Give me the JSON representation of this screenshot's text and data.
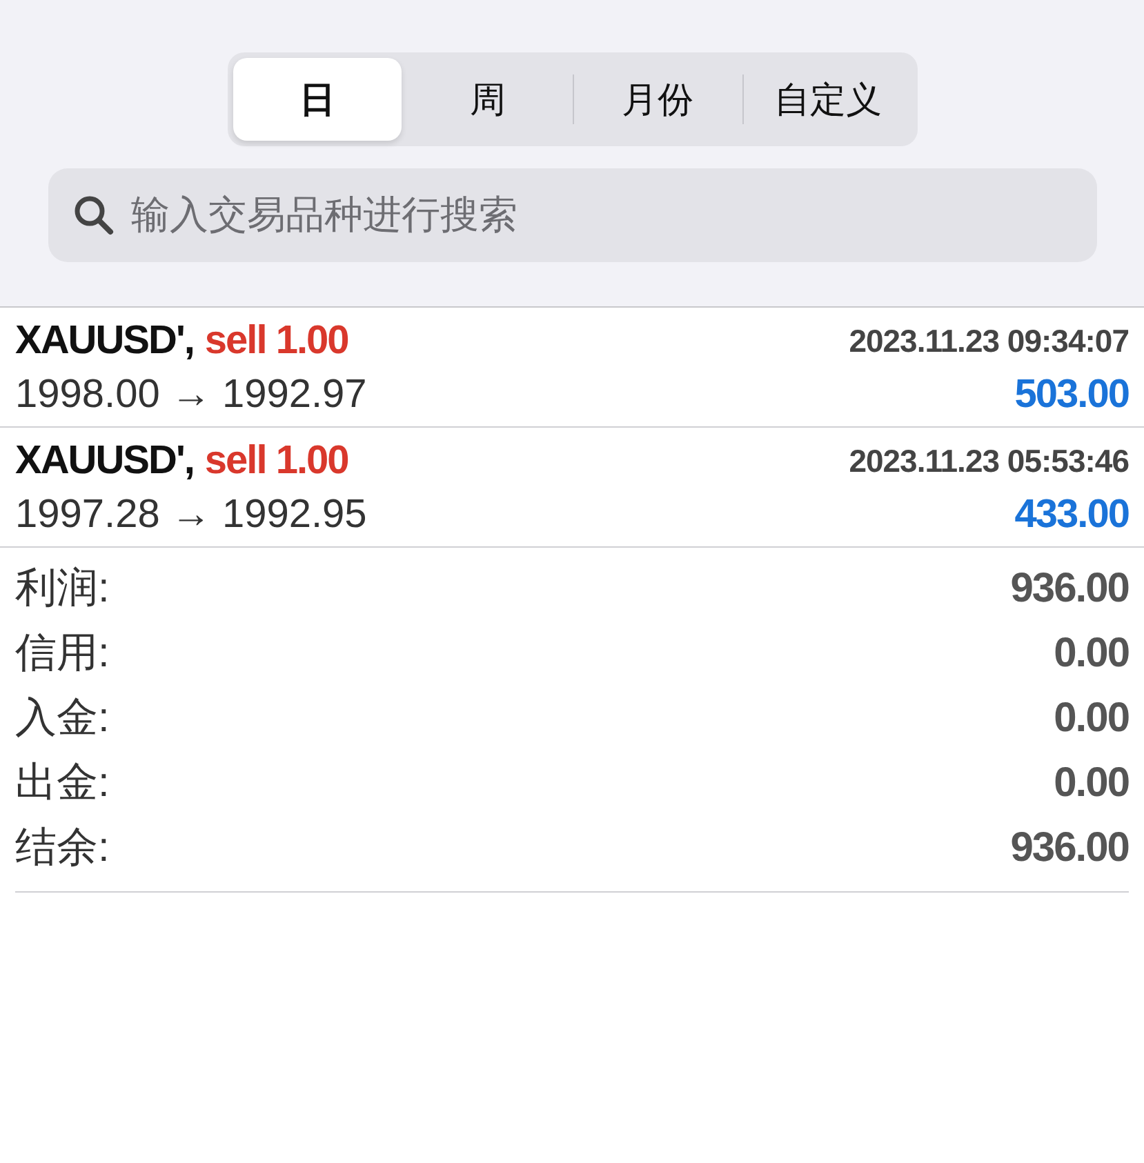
{
  "segments": [
    {
      "label": "日",
      "selected": true
    },
    {
      "label": "周",
      "selected": false
    },
    {
      "label": "月份",
      "selected": false
    },
    {
      "label": "自定义",
      "selected": false
    }
  ],
  "search": {
    "placeholder": "输入交易品种进行搜索"
  },
  "trades": [
    {
      "symbol": "XAUUSD',",
      "order": "sell 1.00",
      "time": "2023.11.23 09:34:07",
      "prices": "1998.00 → 1992.97",
      "profit": "503.00"
    },
    {
      "symbol": "XAUUSD',",
      "order": "sell 1.00",
      "time": "2023.11.23 05:53:46",
      "prices": "1997.28 → 1992.95",
      "profit": "433.00"
    }
  ],
  "summary": [
    {
      "label": "利润:",
      "value": "936.00"
    },
    {
      "label": "信用:",
      "value": "0.00"
    },
    {
      "label": "入金:",
      "value": "0.00"
    },
    {
      "label": "出金:",
      "value": "0.00"
    },
    {
      "label": "结余:",
      "value": "936.00"
    }
  ]
}
